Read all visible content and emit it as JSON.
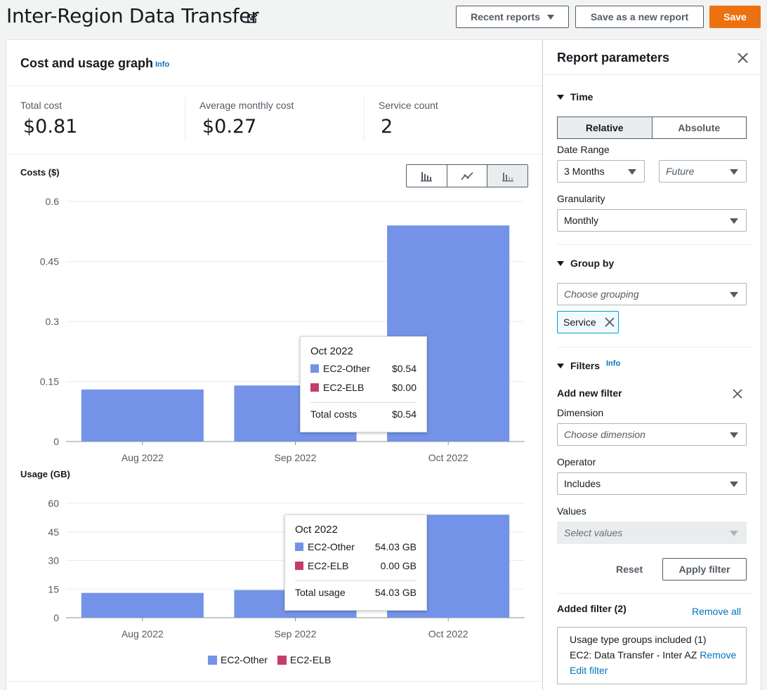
{
  "header": {
    "title": "Inter-Region Data Transfer",
    "recent_reports": "Recent reports",
    "save_as_new": "Save as a new report",
    "save": "Save"
  },
  "graph_panel": {
    "title": "Cost and usage graph",
    "info": "Info",
    "stats": [
      {
        "label": "Total cost",
        "value": "$0.81"
      },
      {
        "label": "Average monthly cost",
        "value": "$0.27"
      },
      {
        "label": "Service count",
        "value": "2"
      }
    ]
  },
  "chart_data": [
    {
      "type": "bar",
      "title": "Costs ($)",
      "categories": [
        "Aug 2022",
        "Sep 2022",
        "Oct 2022"
      ],
      "series": [
        {
          "name": "EC2-Other",
          "values": [
            0.13,
            0.14,
            0.54
          ]
        },
        {
          "name": "EC2-ELB",
          "values": [
            0,
            0,
            0
          ]
        }
      ],
      "yticks": [
        "0",
        "0.15",
        "0.3",
        "0.45",
        "0.6"
      ],
      "ylim": [
        0,
        0.6
      ],
      "grid": true,
      "tooltip": {
        "title": "Oct 2022",
        "rows": [
          {
            "label": "EC2-Other",
            "value": "$0.54"
          },
          {
            "label": "EC2-ELB",
            "value": "$0.00"
          }
        ],
        "total_label": "Total costs",
        "total_value": "$0.54"
      }
    },
    {
      "type": "bar",
      "title": "Usage (GB)",
      "categories": [
        "Aug 2022",
        "Sep 2022",
        "Oct 2022"
      ],
      "series": [
        {
          "name": "EC2-Other",
          "values": [
            13,
            14.5,
            54.03
          ]
        },
        {
          "name": "EC2-ELB",
          "values": [
            0,
            0,
            0
          ]
        }
      ],
      "yticks": [
        "0",
        "15",
        "30",
        "45",
        "60"
      ],
      "ylim": [
        0,
        60
      ],
      "grid": true,
      "tooltip": {
        "title": "Oct 2022",
        "rows": [
          {
            "label": "EC2-Other",
            "value": "54.03 GB"
          },
          {
            "label": "EC2-ELB",
            "value": "0.00 GB"
          }
        ],
        "total_label": "Total usage",
        "total_value": "54.03 GB"
      }
    }
  ],
  "legend": [
    {
      "name": "EC2-Other",
      "color": "#7492e7"
    },
    {
      "name": "EC2-ELB",
      "color": "#c33d69"
    }
  ],
  "params": {
    "title": "Report parameters",
    "time": {
      "heading": "Time",
      "relative": "Relative",
      "absolute": "Absolute",
      "date_range_label": "Date Range",
      "date_range_value": "3 Months",
      "future_placeholder": "Future",
      "granularity_label": "Granularity",
      "granularity_value": "Monthly"
    },
    "group_by": {
      "heading": "Group by",
      "placeholder": "Choose grouping",
      "token": "Service"
    },
    "filters": {
      "heading": "Filters",
      "info": "Info",
      "add_new": "Add new filter",
      "dimension_label": "Dimension",
      "dimension_placeholder": "Choose dimension",
      "operator_label": "Operator",
      "operator_value": "Includes",
      "values_label": "Values",
      "values_placeholder": "Select values",
      "reset": "Reset",
      "apply": "Apply filter",
      "added_label": "Added filter (2)",
      "remove_all": "Remove all",
      "added_line1": "Usage type groups included (1)",
      "added_line2": "EC2: Data Transfer - Inter AZ",
      "remove": "Remove",
      "edit": "Edit filter"
    }
  },
  "colors": {
    "series_ec2_other": "#7492e7",
    "series_ec2_elb": "#c33d69",
    "primary": "#ec7211",
    "link": "#0073bb"
  }
}
